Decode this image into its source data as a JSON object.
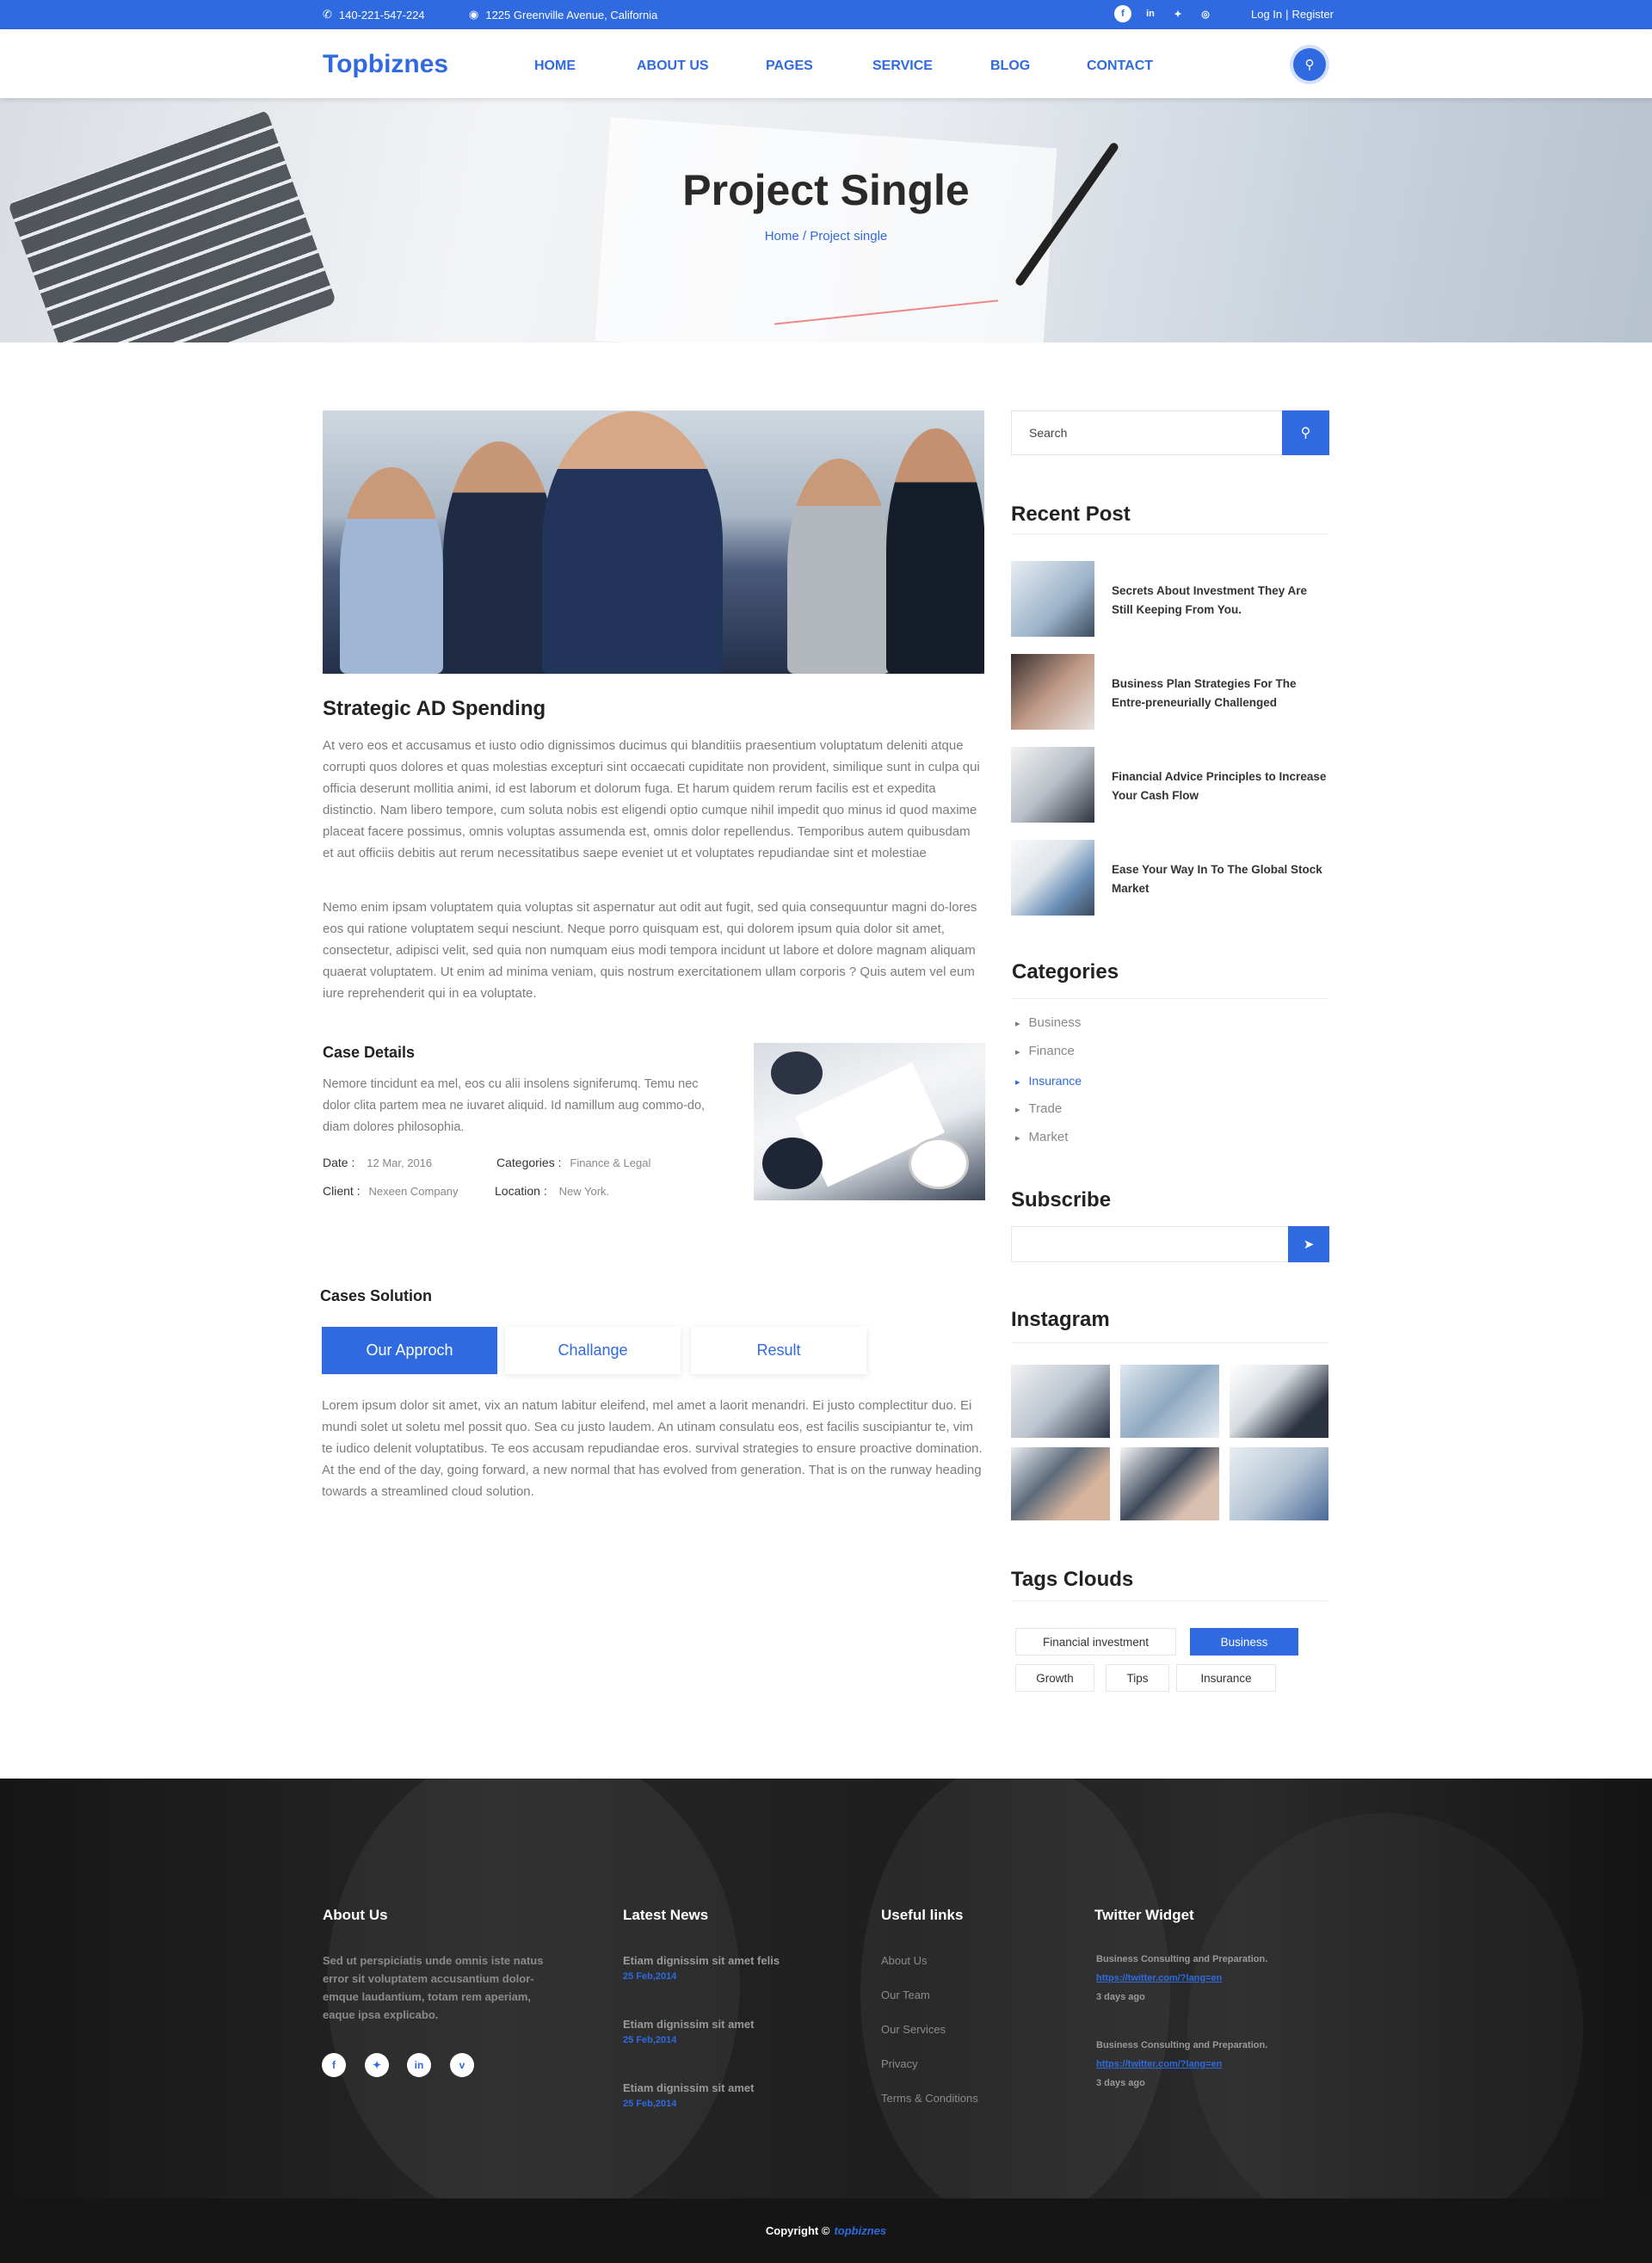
{
  "topbar": {
    "phone": "140-221-547-224",
    "address": "1225 Greenville Avenue, California",
    "login": "Log In",
    "register": "Register",
    "social_icons": [
      "facebook-icon",
      "linkedin-icon",
      "twitter-icon",
      "dribbble-icon"
    ]
  },
  "header": {
    "logo": "Topbiznes",
    "nav": [
      "HOME",
      "ABOUT US",
      "PAGES",
      "SERVICE",
      "BLOG",
      "CONTACT"
    ]
  },
  "hero": {
    "title": "Project Single",
    "breadcrumb": "Home / Project single"
  },
  "main": {
    "title": "Strategic AD Spending",
    "para1": "At vero eos et accusamus et iusto odio dignissimos ducimus qui blanditiis praesentium voluptatum deleniti atque corrupti quos dolores et quas molestias excepturi sint occaecati cupiditate non provident, similique sunt in culpa qui officia deserunt mollitia animi, id est laborum et dolorum fuga. Et harum quidem rerum facilis est et expedita distinctio. Nam libero tempore, cum soluta nobis est eligendi optio cumque nihil impedit quo minus id quod maxime placeat facere possimus, omnis voluptas assumenda est, omnis dolor repellendus. Temporibus autem quibusdam et aut officiis debitis aut rerum necessitatibus saepe eveniet ut et voluptates repudiandae sint et molestiae",
    "para2": "Nemo enim ipsam voluptatem quia voluptas sit aspernatur aut odit aut fugit, sed quia consequuntur magni do-lores eos qui ratione voluptatem sequi nesciunt. Neque porro quisquam est, qui dolorem ipsum quia dolor sit amet, consectetur, adipisci velit, sed quia non numquam eius modi tempora incidunt ut labore et dolore magnam aliquam quaerat voluptatem. Ut enim ad minima veniam, quis nostrum exercitationem ullam corporis ? Quis autem vel eum iure reprehenderit qui in ea voluptate.",
    "case": {
      "title": "Case Details",
      "text": "Nemore tincidunt ea mel, eos cu alii insolens signiferumq. Temu nec dolor clita partem mea ne iuvaret aliquid. Id namillum aug commo-do, diam dolores philosophia.",
      "date_label": "Date :",
      "date": "12 Mar, 2016",
      "categories_label": "Categories :",
      "categories": "Finance & Legal",
      "client_label": "Client :",
      "client": "Nexeen Company",
      "location_label": "Location :",
      "location": "New York."
    },
    "solution": {
      "title": "Cases Solution",
      "tabs": [
        "Our Approch",
        "Challange",
        "Result"
      ],
      "text": "Lorem ipsum dolor sit amet, vix an natum labitur eleifend, mel amet a laorit menandri. Ei justo complectitur duo. Ei mundi solet ut soletu mel possit quo. Sea cu justo laudem. An utinam consulatu eos, est facilis suscipiantur te, vim te iudico delenit voluptatibus. Te eos accusam repudiandae eros. survival strategies to ensure proactive domination. At the end of the day, going forward, a new normal that has evolved from generation. That is on the runway heading towards a streamlined cloud solution."
    }
  },
  "sidebar": {
    "search_placeholder": "Search",
    "recent_title": "Recent Post",
    "recent": [
      "Secrets About Investment They Are Still Keeping From You.",
      "Business Plan Strategies For The Entre-preneurially Challenged",
      "Financial Advice Principles to Increase Your Cash Flow",
      "Ease Your Way In To The Global Stock Market"
    ],
    "categories_title": "Categories",
    "categories": [
      "Business",
      "Finance",
      "Insurance",
      "Trade",
      "Market"
    ],
    "subscribe_title": "Subscribe",
    "instagram_title": "Instagram",
    "tags_title": "Tags Clouds",
    "tags": [
      "Financial investment",
      "Business",
      "Growth",
      "Tips",
      "Insurance"
    ]
  },
  "footer": {
    "about_title": "About Us",
    "about_text": "Sed ut perspiciatis unde omnis iste natus error sit voluptatem accusantium dolor-emque laudantium, totam rem aperiam, eaque ipsa  explicabo.",
    "news_title": "Latest News",
    "news": [
      {
        "title": "Etiam dignissim sit amet felis",
        "date": "25 Feb,2014"
      },
      {
        "title": "Etiam dignissim sit amet",
        "date": "25 Feb,2014"
      },
      {
        "title": "Etiam dignissim sit amet",
        "date": "25 Feb,2014"
      }
    ],
    "links_title": "Useful links",
    "links": [
      "About Us",
      "Our Team",
      "Our Services",
      "Privacy",
      "Terms & Conditions"
    ],
    "twitter_title": "Twitter Widget",
    "tweets": [
      {
        "text": "Business Consulting and Preparation.",
        "link": "https://twitter.com/?lang=en",
        "time": "3 days ago"
      },
      {
        "text": "Business Consulting and Preparation.",
        "link": "https://twitter.com/?lang=en",
        "time": "3 days ago"
      }
    ],
    "copyright_prefix": "Copyright ©",
    "copyright_brand": "topbiznes"
  },
  "colors": {
    "accent": "#2f6ae0"
  }
}
